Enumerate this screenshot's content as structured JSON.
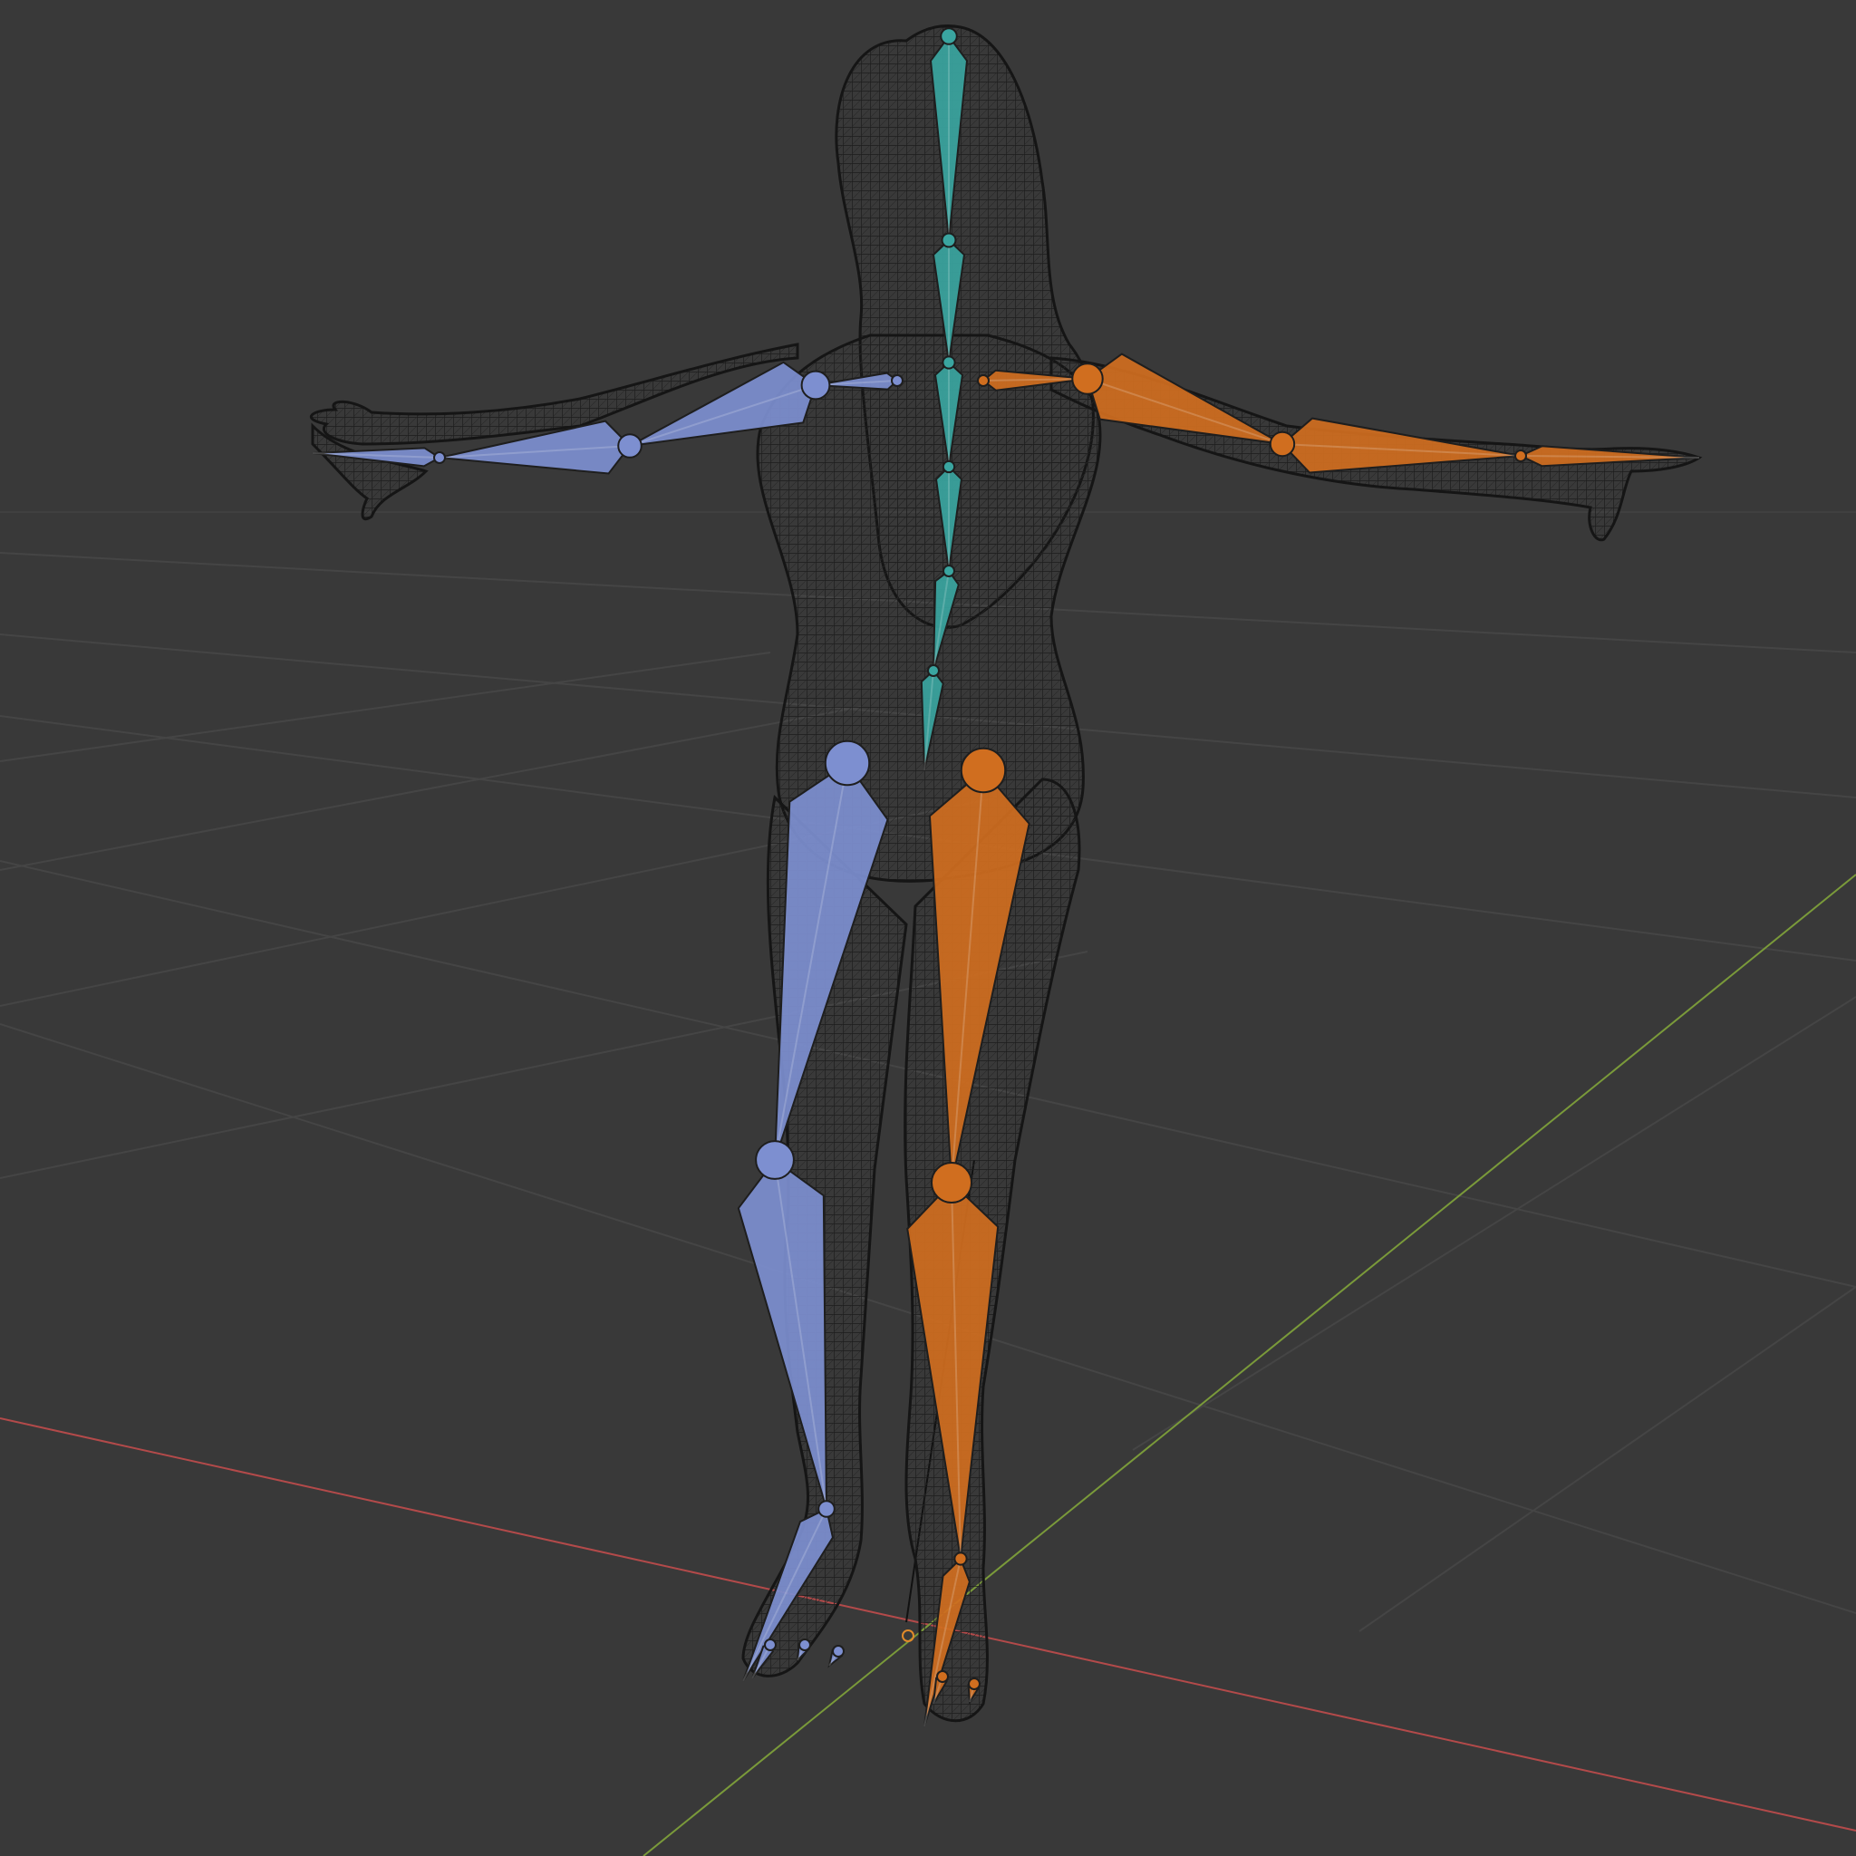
{
  "viewport": {
    "background": "#393939",
    "grid_color": "#444444",
    "axis_x_color": "#b34a4a",
    "axis_y_color": "#7a9a3a"
  },
  "armature": {
    "spine_color": "#3aa5a0",
    "left_side_color": "#7d8fd0",
    "right_side_color": "#d06e1f",
    "bones": [
      {
        "name": "head",
        "side": "center"
      },
      {
        "name": "neck",
        "side": "center"
      },
      {
        "name": "spine-3",
        "side": "center"
      },
      {
        "name": "spine-2",
        "side": "center"
      },
      {
        "name": "spine-1",
        "side": "center"
      },
      {
        "name": "hips",
        "side": "center"
      },
      {
        "name": "shoulder",
        "side": "left"
      },
      {
        "name": "upper-arm",
        "side": "left"
      },
      {
        "name": "forearm",
        "side": "left"
      },
      {
        "name": "hand",
        "side": "left"
      },
      {
        "name": "shoulder",
        "side": "right"
      },
      {
        "name": "upper-arm",
        "side": "right"
      },
      {
        "name": "forearm",
        "side": "right"
      },
      {
        "name": "hand",
        "side": "right"
      },
      {
        "name": "thigh",
        "side": "left"
      },
      {
        "name": "shin",
        "side": "left"
      },
      {
        "name": "foot",
        "side": "left"
      },
      {
        "name": "thigh",
        "side": "right"
      },
      {
        "name": "shin",
        "side": "right"
      },
      {
        "name": "foot",
        "side": "right"
      }
    ]
  },
  "mesh": {
    "wire_color": "#1a1a1a",
    "fill_color": "#2e2e2e"
  }
}
